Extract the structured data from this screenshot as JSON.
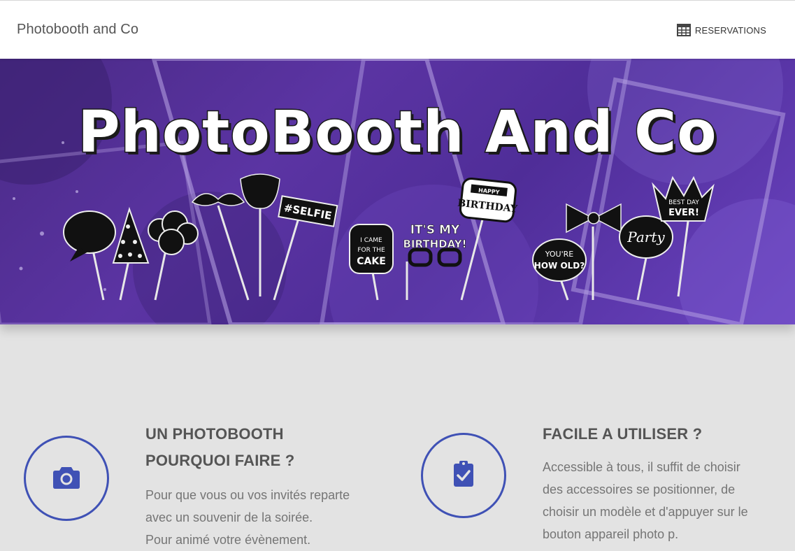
{
  "header": {
    "brand": "Photobooth and Co",
    "nav": {
      "reservations_label": "RESERVATIONS",
      "reservations_icon": "calendar-table-icon"
    }
  },
  "hero": {
    "title": "PhotoBooth And Co",
    "props": {
      "selfie": "#SELFIE",
      "came_for_cake": "I CAME FOR THE CAKE",
      "its_my_birthday": "IT'S MY BIRTHDAY!",
      "happy_birthday": "HAPPY BIRTHDAY",
      "youre_how_old": "YOU'RE HOW OLD?",
      "party": "Party",
      "best_day_ever": "BEST DAY EVER!"
    }
  },
  "features": [
    {
      "icon": "camera-icon",
      "title_line1": "UN PHOTOBOOTH",
      "title_line2": "POURQUOI FAIRE ?",
      "text_lines": [
        "Pour que vous ou vos invités reparte",
        "avec un souvenir de la soirée.",
        "Pour animé votre évènement."
      ]
    },
    {
      "icon": "clipboard-check-icon",
      "title_line1": "FACILE A UTILISER ?",
      "text_lines": [
        "Accessible à tous, il suffit de choisir",
        "des accessoires se positionner, de",
        "choisir un modèle et d'appuyer sur le",
        "bouton appareil photo p."
      ]
    }
  ],
  "colors": {
    "accent": "#3f51b5",
    "hero_purple": "#5b34a3",
    "section_bg": "#e3e3e3"
  }
}
